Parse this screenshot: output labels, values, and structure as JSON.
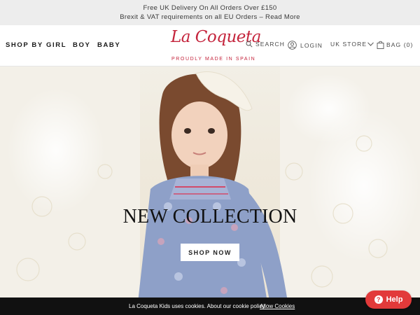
{
  "promo": {
    "line1": "Free UK Delivery On All Orders Over £150",
    "line2": "Brexit & VAT requirements on all EU Orders – Read More"
  },
  "nav": {
    "items": [
      {
        "label": "SHOP BY"
      },
      {
        "label": "GIRL"
      },
      {
        "label": "BOY"
      },
      {
        "label": "BABY"
      }
    ]
  },
  "logo": {
    "name": "La Coqueta",
    "tagline": "PROUDLY MADE IN SPAIN",
    "color": "#c4243c"
  },
  "utility": {
    "search_label": "SEARCH",
    "login_label": "LOGIN",
    "store_label": "UK STORE",
    "bag_label": "BAG (0)",
    "icons": [
      "search-icon",
      "user-icon",
      "chevron-down-icon",
      "bag-icon"
    ]
  },
  "hero": {
    "title": "NEW COLLECTION",
    "button_label": "SHOP NOW"
  },
  "cookie": {
    "text": "La Coqueta Kids uses cookies. About our cookie policy.",
    "link_label": "Allow Cookies"
  },
  "help": {
    "label": "Help",
    "color": "#e23a3a"
  }
}
